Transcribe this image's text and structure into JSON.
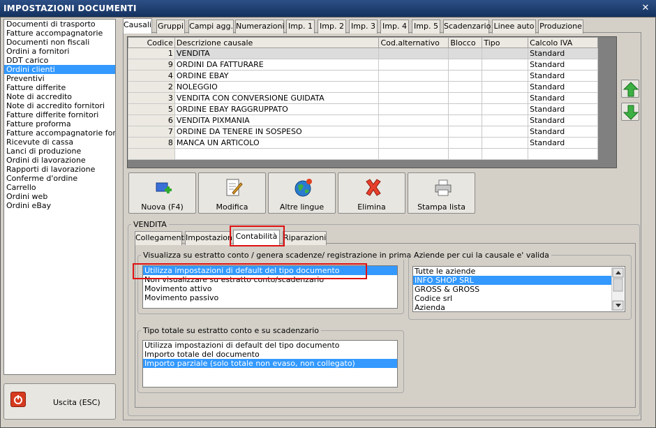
{
  "window": {
    "title": "IMPOSTAZIONI DOCUMENTI",
    "close_glyph": "✕"
  },
  "doc_types": [
    "Documenti di trasporto",
    "Fatture accompagnatorie",
    "Documenti non fiscali",
    "Ordini a fornitori",
    "DDT carico",
    "Ordini clienti",
    "Preventivi",
    "Fatture differite",
    "Note di accredito",
    "Note di accredito fornitori",
    "Fatture differite fornitori",
    "Fatture proforma",
    "Fatture accompagnatorie fornito",
    "Ricevute di cassa",
    "Lanci di produzione",
    "Ordini di lavorazione",
    "Rapporti di lavorazione",
    "Conferme d'ordine",
    "Carrello",
    "Ordini web",
    "Ordini eBay"
  ],
  "doc_types_selected": 5,
  "exit_label": "Uscita (ESC)",
  "tabs": [
    "Causali",
    "Gruppi",
    "Campi agg.",
    "Numerazioni",
    "Imp. 1",
    "Imp. 2",
    "Imp. 3",
    "Imp. 4",
    "Imp. 5",
    "Scadenzario",
    "Linee auto",
    "Produzione"
  ],
  "grid": {
    "headers": [
      "Codice",
      "Descrizione causale",
      "Cod.alternativo",
      "Blocco",
      "Tipo",
      "Calcolo IVA"
    ],
    "rows": [
      [
        "1",
        "VENDITA",
        "",
        "",
        "",
        "Standard"
      ],
      [
        "9",
        "ORDINI DA FATTURARE",
        "",
        "",
        "",
        "Standard"
      ],
      [
        "4",
        "ORDINE EBAY",
        "",
        "",
        "",
        "Standard"
      ],
      [
        "2",
        "NOLEGGIO",
        "",
        "",
        "",
        "Standard"
      ],
      [
        "3",
        "VENDITA CON CONVERSIONE GUIDATA",
        "",
        "",
        "",
        "Standard"
      ],
      [
        "5",
        "ORDINE EBAY RAGGRUPPATO",
        "",
        "",
        "",
        "Standard"
      ],
      [
        "6",
        "VENDITA PIXMANIA",
        "",
        "",
        "",
        "Standard"
      ],
      [
        "7",
        "ORDINE DA TENERE IN SOSPESO",
        "",
        "",
        "",
        "Standard"
      ],
      [
        "8",
        "MANCA UN ARTICOLO",
        "",
        "",
        "",
        "Standard"
      ]
    ]
  },
  "toolbar": {
    "new": "Nuova (F4)",
    "edit": "Modifica",
    "languages": "Altre lingue",
    "delete": "Elimina",
    "print": "Stampa lista"
  },
  "group_title": "VENDITA",
  "subtabs": [
    "Collegamenti",
    "Impostazioni",
    "Contabilità",
    "Riparazioni"
  ],
  "visualizza": {
    "title": "Visualizza su estratto conto / genera scadenze/ registrazione  in prima nota",
    "items": [
      "Utilizza impostazioni di default del tipo documento",
      "Non visualizzare su estratto conto/scadenzario",
      "Movimento attivo",
      "Movimento passivo"
    ],
    "selected": 0
  },
  "aziende": {
    "title": "Aziende per cui la causale e' valida",
    "items": [
      "Tutte le aziende",
      "INFO SHOP SRL",
      "GROSS & GROSS",
      "Codice srl",
      "Azienda"
    ],
    "selected": 1
  },
  "tipo_totale": {
    "title": "Tipo totale su estratto conto e su scadenzario",
    "items": [
      "Utilizza impostazioni di default del tipo documento",
      "Importo totale del documento",
      "Importo parziale (solo totale non evaso, non collegato)"
    ],
    "selected": 2
  }
}
